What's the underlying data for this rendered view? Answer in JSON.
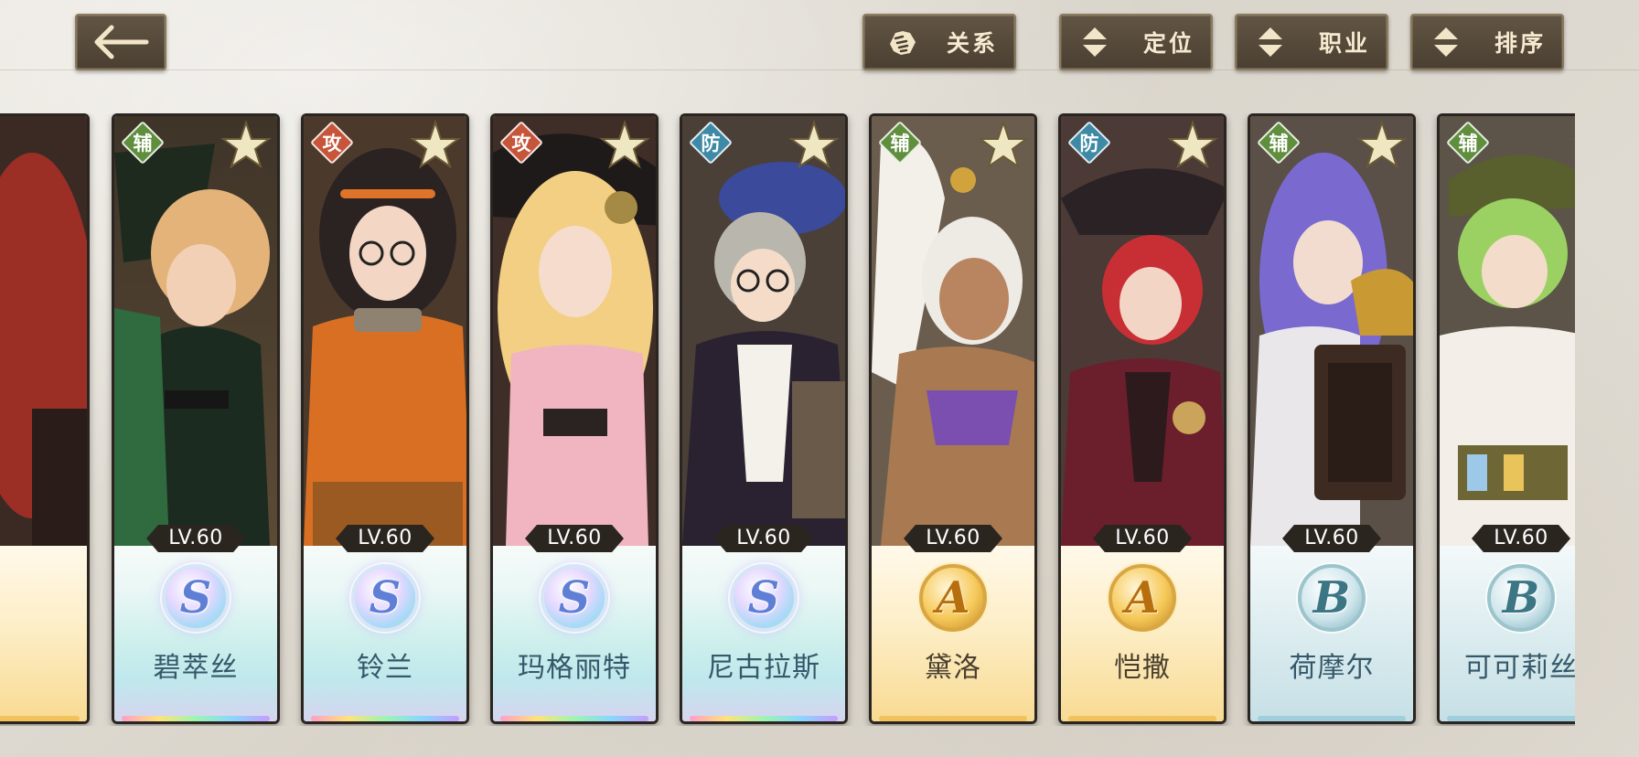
{
  "header": {
    "back_icon": "back-arrow-icon",
    "buttons": [
      {
        "label": "关系",
        "icon": "handshake-icon"
      },
      {
        "label": "定位",
        "icon": "sort-updown-icon"
      },
      {
        "label": "职业",
        "icon": "sort-updown-icon"
      },
      {
        "label": "排序",
        "icon": "sort-updown-icon"
      }
    ]
  },
  "characters": [
    {
      "name": "碧萃丝",
      "role": "辅",
      "level": "LV.60",
      "rank": "S"
    },
    {
      "name": "铃兰",
      "role": "攻",
      "level": "LV.60",
      "rank": "S"
    },
    {
      "name": "玛格丽特",
      "role": "攻",
      "level": "LV.60",
      "rank": "S"
    },
    {
      "name": "尼古拉斯",
      "role": "防",
      "level": "LV.60",
      "rank": "S"
    },
    {
      "name": "黛洛",
      "role": "辅",
      "level": "LV.60",
      "rank": "A"
    },
    {
      "name": "恺撒",
      "role": "防",
      "level": "LV.60",
      "rank": "A"
    },
    {
      "name": "荷摩尔",
      "role": "辅",
      "level": "LV.60",
      "rank": "B"
    },
    {
      "name": "可可莉丝",
      "role": "辅",
      "level": "LV.60",
      "rank": "B"
    }
  ],
  "colors": {
    "support": "#5f8e3d",
    "attack": "#c6553a",
    "defense": "#3e8aa6",
    "button_bg": "#4f4335",
    "button_text": "#f3e6c8"
  }
}
